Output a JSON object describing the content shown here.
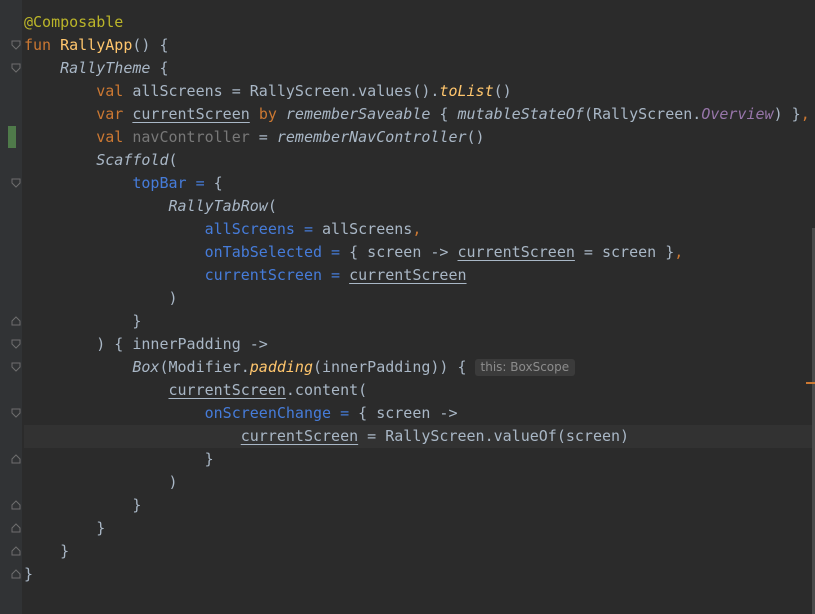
{
  "editor": {
    "language": "Kotlin",
    "theme": "Darcula",
    "colors": {
      "background": "#2b2b2b",
      "keyword": "#cc7832",
      "function_declaration": "#ffc66d",
      "annotation": "#bbb529",
      "named_argument": "#467cda",
      "property": "#9876aa",
      "plain_text": "#a9b7c6"
    },
    "fold_icon": "fold-marker-icon",
    "inlay_hint": "this: BoxScope"
  }
}
